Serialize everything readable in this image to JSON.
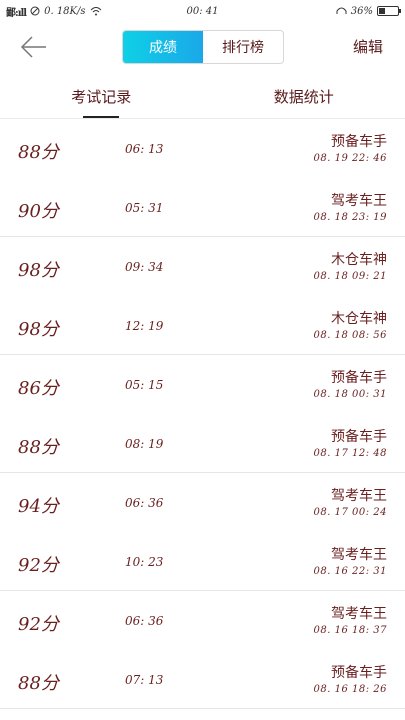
{
  "status_bar": {
    "carrier": "鄙:ıll",
    "speed": "0. 18K/s",
    "time": "00: 41",
    "battery": "36%",
    "battery_level": 0.36
  },
  "header": {
    "seg_scores": "成绩",
    "seg_ranking": "排行榜",
    "edit": "编辑",
    "active_segment": "scores"
  },
  "tabs": [
    {
      "label": "考试记录",
      "active": true
    },
    {
      "label": "数据统计",
      "active": false
    }
  ],
  "records": [
    {
      "score": "88分",
      "duration": "06: 13",
      "title": "预备车手",
      "date": "08. 19  22: 46"
    },
    {
      "score": "90分",
      "duration": "05: 31",
      "title": "驾考车王",
      "date": "08. 18  23: 19"
    },
    {
      "score": "98分",
      "duration": "09: 34",
      "title": "木仓车神",
      "date": "08. 18  09: 21"
    },
    {
      "score": "98分",
      "duration": "12: 19",
      "title": "木仓车神",
      "date": "08. 18  08: 56"
    },
    {
      "score": "86分",
      "duration": "05: 15",
      "title": "预备车手",
      "date": "08. 18  00: 31"
    },
    {
      "score": "88分",
      "duration": "08: 19",
      "title": "预备车手",
      "date": "08. 17  12: 48"
    },
    {
      "score": "94分",
      "duration": "06: 36",
      "title": "驾考车王",
      "date": "08. 17  00: 24"
    },
    {
      "score": "92分",
      "duration": "10: 23",
      "title": "驾考车王",
      "date": "08. 16  22: 31"
    },
    {
      "score": "92分",
      "duration": "06: 36",
      "title": "驾考车王",
      "date": "08. 16  18: 37"
    },
    {
      "score": "88分",
      "duration": "07: 13",
      "title": "预备车手",
      "date": "08. 16  18: 26"
    }
  ]
}
